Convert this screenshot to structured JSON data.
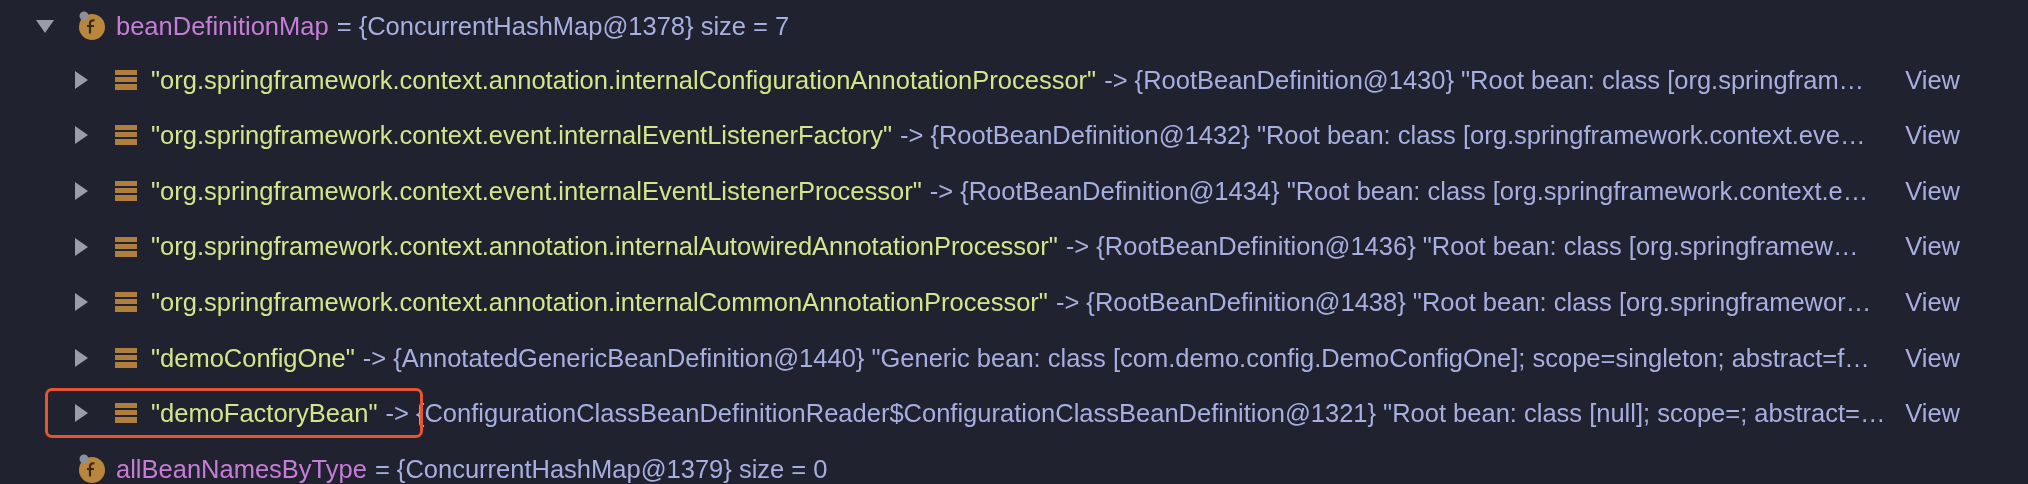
{
  "variables": [
    {
      "kind": "field",
      "name": "beanDefinitionMap",
      "value": "= {ConcurrentHashMap@1378}  size = 7",
      "expanded": true,
      "children": [
        {
          "kind": "entry",
          "key": "\"org.springframework.context.annotation.internalConfigurationAnnotationProcessor\"",
          "value": "-> {RootBeanDefinition@1430} \"Root bean: class [org.springfram…",
          "action": "View",
          "expanded": false,
          "highlighted": false
        },
        {
          "kind": "entry",
          "key": "\"org.springframework.context.event.internalEventListenerFactory\"",
          "value": "-> {RootBeanDefinition@1432} \"Root bean: class [org.springframework.context.eve…",
          "action": "View",
          "expanded": false,
          "highlighted": false
        },
        {
          "kind": "entry",
          "key": "\"org.springframework.context.event.internalEventListenerProcessor\"",
          "value": "-> {RootBeanDefinition@1434} \"Root bean: class [org.springframework.context.e…",
          "action": "View",
          "expanded": false,
          "highlighted": false
        },
        {
          "kind": "entry",
          "key": "\"org.springframework.context.annotation.internalAutowiredAnnotationProcessor\"",
          "value": "-> {RootBeanDefinition@1436} \"Root bean: class [org.springframew…",
          "action": "View",
          "expanded": false,
          "highlighted": false
        },
        {
          "kind": "entry",
          "key": "\"org.springframework.context.annotation.internalCommonAnnotationProcessor\"",
          "value": "-> {RootBeanDefinition@1438} \"Root bean: class [org.springframewor…",
          "action": "View",
          "expanded": false,
          "highlighted": false
        },
        {
          "kind": "entry",
          "key": "\"demoConfigOne\"",
          "value": "-> {AnnotatedGenericBeanDefinition@1440} \"Generic bean: class [com.demo.config.DemoConfigOne]; scope=singleton; abstract=f…",
          "action": "View",
          "expanded": false,
          "highlighted": false
        },
        {
          "kind": "entry",
          "key": "\"demoFactoryBean\"",
          "value": "-> {ConfigurationClassBeanDefinitionReader$ConfigurationClassBeanDefinition@1321} \"Root bean: class [null]; scope=; abstract=…",
          "action": "View",
          "expanded": false,
          "highlighted": true
        }
      ]
    },
    {
      "kind": "field",
      "name": "allBeanNamesByType",
      "value": "= {ConcurrentHashMap@1379}  size = 0"
    }
  ]
}
